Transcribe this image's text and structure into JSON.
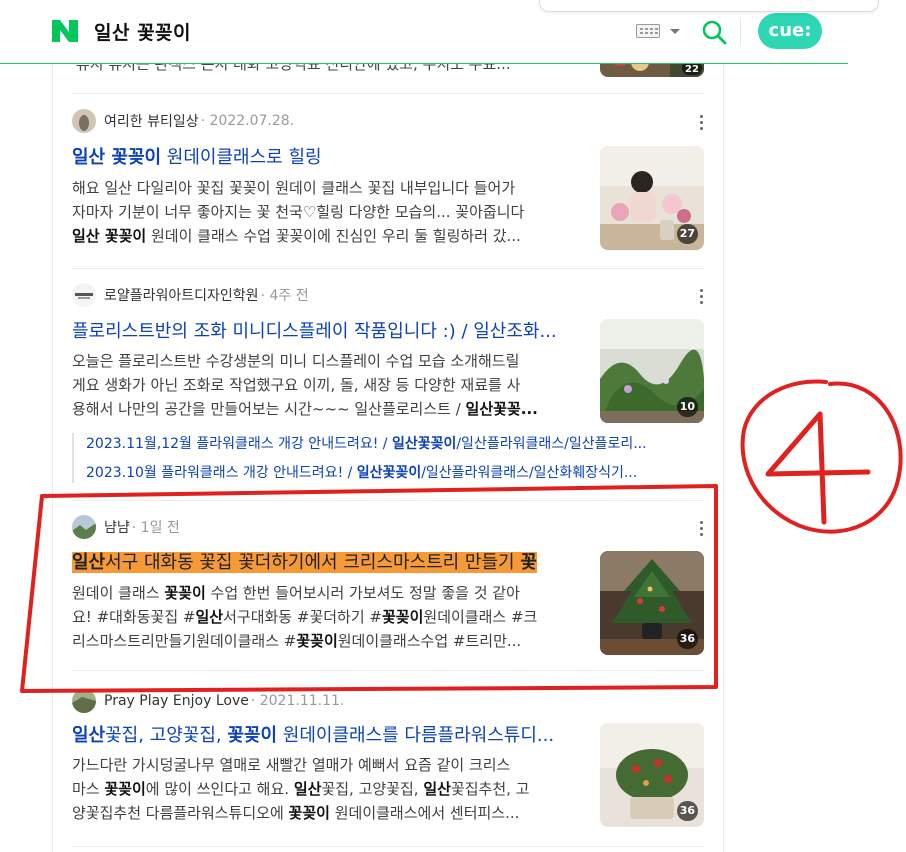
{
  "header": {
    "query": "일산 꽃꽂이",
    "logo_icon": "naver-n-logo-icon",
    "cue_label": "cue:",
    "colors": {
      "brand": "#03c75a",
      "cue": "#2ed6b4",
      "link": "#0c43b7",
      "highlight": "#f59a36",
      "annotation": "#e1211f"
    }
  },
  "top_partial": {
    "snippet": "뷰지 뷰지는 관객스 쓴지 대화 고양역표 신디안에 였고, 우치도 우표..."
  },
  "results": [
    {
      "author": "여리한 뷰티일상",
      "date": "· 2022.07.28.",
      "title_parts": [
        "일산 꽃꽂이",
        " 원데이클래스로 힐링"
      ],
      "snippet_line1": "해요 일산 다일리아 꽃집 꽃꽂이 원데이 클래스 꽃집 내부입니다 들어가",
      "snippet_line2": "자마자 기분이 너무 좋아지는 꽃 천국♡힐링 다양한 모습의... 꽂아줍니다",
      "snippet_line3_bold": "일산 꽃꽂이",
      "snippet_line3_rest": " 원데이 클래스 수업 꽃꽂이에 진심인 우리 둘 힐링하러 갔...",
      "image_count": "27"
    },
    {
      "author": "로얄플라워아트디자인학원",
      "date": "· 4주 전",
      "title": "플로리스트반의 조화 미니디스플레이 작품입니다 :) / 일산조화...",
      "snippet_line1": "오늘은 플로리스트반 수강생분의 미니 디스플레이 수업 모습 소개해드릴",
      "snippet_line2": "게요 생화가 아닌 조화로 작업했구요 이끼, 돌, 새장 등 다양한 재료를 사",
      "snippet_line3_rest": "용해서 나만의 공간을 만들어보는 시간~~~ 일산플로리스트 / ",
      "snippet_line3_bold": "일산꽃꽂...",
      "image_count": "10",
      "sub_posts": [
        {
          "pre": "2023.11월,12월 플라워클래스 개강 안내드려요! / ",
          "bold": "일산꽃꽂이",
          "post": "/일산플라워클래스/일산플로리..."
        },
        {
          "pre": "2023.10월 플라워클래스 개강 안내드려요! / ",
          "bold": "일산꽃꽂이",
          "post": "/일산플라워클래스/일산화훼장식기..."
        }
      ]
    },
    {
      "author": "냠냠",
      "date": "· 1일 전",
      "title_bold": "일산",
      "title_rest": "서구 대화동 꽃집 꽃더하기에서 크리스마스트리 만들기 ",
      "title_bold_end": "꽃",
      "snippet_line1_pre": "원데이 클래스 ",
      "snippet_line1_bold": "꽃꽂이",
      "snippet_line1_post": " 수업 한번 들어보시러 가보셔도 정말 좋을 것 같아",
      "snippet_line2_pre": "요! #대화동꽃집 #",
      "snippet_line2_bold1": "일산",
      "snippet_line2_mid": "서구대화동 #꽃더하기 #",
      "snippet_line2_bold2": "꽃꽂이",
      "snippet_line2_post": "원데이클래스 #크",
      "snippet_line3_pre": "리스마스트리만들기원데이클래스 #",
      "snippet_line3_bold": "꽃꽂이",
      "snippet_line3_post": "원데이클래스수업 #트리만...",
      "image_count": "36"
    },
    {
      "author": "Pray Play Enjoy Love",
      "date": "· 2021.11.11.",
      "title_b1": "일산",
      "title_t1": "꽃집, 고양꽃집, ",
      "title_b2": "꽃꽂이",
      "title_t2": " 원데이클래스를 다름플라워스튜디...",
      "snippet_line1": "가느다란 가시덩굴나무 열매로 새빨간 열매가 예뻐서 요즘 같이 크리스",
      "snippet_line2_pre": "마스 ",
      "snippet_line2_bold": "꽃꽂이",
      "snippet_line2_post": "에 많이 쓰인다고 해요. ",
      "snippet_line2_b2": "일산",
      "snippet_line2_t2": "꽃집, 고양꽃집, ",
      "snippet_line2_b3": "일산",
      "snippet_line2_t3": "꽃집추천, 고",
      "snippet_line3_pre": "양꽃집추천 다름플라워스튜디오에 ",
      "snippet_line3_bold": "꽃꽂이",
      "snippet_line3_post": " 원데이클래스에서 센터피스...",
      "image_count": "36"
    }
  ],
  "annotation": {
    "label": "4"
  }
}
